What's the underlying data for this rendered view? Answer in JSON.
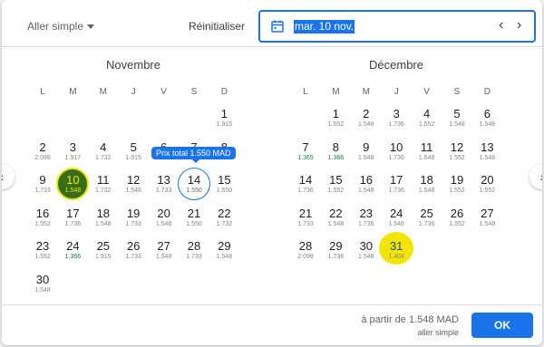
{
  "header": {
    "trip_type": "Aller simple",
    "reset_label": "Réinitialiser",
    "selected_date": "mar. 10 nov.",
    "prev_arrow": "‹",
    "next_arrow": "›"
  },
  "months": [
    {
      "title": "Novembre",
      "weekdays": [
        "L",
        "M",
        "M",
        "J",
        "V",
        "S",
        "D"
      ],
      "days": [
        {
          "d": "1",
          "p": "1.915",
          "row": 0,
          "col": 6
        },
        {
          "d": "2",
          "p": "2.098",
          "row": 1,
          "col": 0
        },
        {
          "d": "3",
          "p": "1.917",
          "row": 1,
          "col": 1
        },
        {
          "d": "4",
          "p": "1.732",
          "row": 1,
          "col": 2
        },
        {
          "d": "5",
          "p": "1.915",
          "row": 1,
          "col": 3
        },
        {
          "d": "6",
          "p": "",
          "row": 1,
          "col": 4
        },
        {
          "d": "7",
          "p": "",
          "row": 1,
          "col": 5
        },
        {
          "d": "8",
          "p": "",
          "row": 1,
          "col": 6
        },
        {
          "d": "9",
          "p": "1.733",
          "row": 2,
          "col": 0
        },
        {
          "d": "10",
          "p": "1.548",
          "row": 2,
          "col": 1,
          "selected": true
        },
        {
          "d": "11",
          "p": "1.732",
          "row": 2,
          "col": 2
        },
        {
          "d": "12",
          "p": "1.548",
          "row": 2,
          "col": 3
        },
        {
          "d": "13",
          "p": "1.733",
          "row": 2,
          "col": 4
        },
        {
          "d": "14",
          "p": "1.550",
          "row": 2,
          "col": 5,
          "hover": true
        },
        {
          "d": "15",
          "p": "1.550",
          "row": 2,
          "col": 6
        },
        {
          "d": "16",
          "p": "1.552",
          "row": 3,
          "col": 0
        },
        {
          "d": "17",
          "p": "1.736",
          "row": 3,
          "col": 1
        },
        {
          "d": "18",
          "p": "1.548",
          "row": 3,
          "col": 2
        },
        {
          "d": "19",
          "p": "1.733",
          "row": 3,
          "col": 3
        },
        {
          "d": "20",
          "p": "1.548",
          "row": 3,
          "col": 4
        },
        {
          "d": "21",
          "p": "1.550",
          "row": 3,
          "col": 5
        },
        {
          "d": "22",
          "p": "1.732",
          "row": 3,
          "col": 6
        },
        {
          "d": "23",
          "p": "1.552",
          "row": 4,
          "col": 0
        },
        {
          "d": "24",
          "p": "1.366",
          "row": 4,
          "col": 1,
          "low": true
        },
        {
          "d": "25",
          "p": "1.915",
          "row": 4,
          "col": 2
        },
        {
          "d": "26",
          "p": "1.733",
          "row": 4,
          "col": 3
        },
        {
          "d": "27",
          "p": "1.548",
          "row": 4,
          "col": 4
        },
        {
          "d": "28",
          "p": "1.733",
          "row": 4,
          "col": 5
        },
        {
          "d": "29",
          "p": "1.548",
          "row": 4,
          "col": 6
        },
        {
          "d": "30",
          "p": "1.548",
          "row": 5,
          "col": 0
        }
      ]
    },
    {
      "title": "Décembre",
      "weekdays": [
        "L",
        "M",
        "M",
        "J",
        "V",
        "S",
        "D"
      ],
      "days": [
        {
          "d": "1",
          "p": "1.552",
          "row": 0,
          "col": 1
        },
        {
          "d": "2",
          "p": "1.548",
          "row": 0,
          "col": 2
        },
        {
          "d": "3",
          "p": "1.736",
          "row": 0,
          "col": 3
        },
        {
          "d": "4",
          "p": "1.552",
          "row": 0,
          "col": 4
        },
        {
          "d": "5",
          "p": "1.548",
          "row": 0,
          "col": 5
        },
        {
          "d": "6",
          "p": "1.548",
          "row": 0,
          "col": 6
        },
        {
          "d": "7",
          "p": "1.365",
          "row": 1,
          "col": 0,
          "low": true
        },
        {
          "d": "8",
          "p": "1.366",
          "row": 1,
          "col": 1,
          "low": true
        },
        {
          "d": "9",
          "p": "1.548",
          "row": 1,
          "col": 2
        },
        {
          "d": "10",
          "p": "1.736",
          "row": 1,
          "col": 3
        },
        {
          "d": "11",
          "p": "1.548",
          "row": 1,
          "col": 4
        },
        {
          "d": "12",
          "p": "1.552",
          "row": 1,
          "col": 5
        },
        {
          "d": "13",
          "p": "1.548",
          "row": 1,
          "col": 6
        },
        {
          "d": "14",
          "p": "1.736",
          "row": 2,
          "col": 0
        },
        {
          "d": "15",
          "p": "1.552",
          "row": 2,
          "col": 1
        },
        {
          "d": "16",
          "p": "1.548",
          "row": 2,
          "col": 2
        },
        {
          "d": "17",
          "p": "1.736",
          "row": 2,
          "col": 3
        },
        {
          "d": "18",
          "p": "1.548",
          "row": 2,
          "col": 4
        },
        {
          "d": "19",
          "p": "1.552",
          "row": 2,
          "col": 5
        },
        {
          "d": "20",
          "p": "1.552",
          "row": 2,
          "col": 6
        },
        {
          "d": "21",
          "p": "1.733",
          "row": 3,
          "col": 0
        },
        {
          "d": "22",
          "p": "1.548",
          "row": 3,
          "col": 1
        },
        {
          "d": "23",
          "p": "1.736",
          "row": 3,
          "col": 2
        },
        {
          "d": "24",
          "p": "1.548",
          "row": 3,
          "col": 3
        },
        {
          "d": "25",
          "p": "1.736",
          "row": 3,
          "col": 4
        },
        {
          "d": "26",
          "p": "1.552",
          "row": 3,
          "col": 5
        },
        {
          "d": "27",
          "p": "1.548",
          "row": 3,
          "col": 6
        },
        {
          "d": "28",
          "p": "2.098",
          "row": 4,
          "col": 0
        },
        {
          "d": "29",
          "p": "1.736",
          "row": 4,
          "col": 1
        },
        {
          "d": "30",
          "p": "1.548",
          "row": 4,
          "col": 2
        },
        {
          "d": "31",
          "p": "1.404",
          "row": 4,
          "col": 3,
          "marked": true
        }
      ]
    }
  ],
  "tooltip": "Prix total 1.550 MAD",
  "side_nav": {
    "left": "‹",
    "right": "›"
  },
  "footer": {
    "price_text": "à partir de 1.548 MAD",
    "sub_text": "aller simple",
    "ok_label": "OK"
  },
  "colors": {
    "accent": "#1a73e8",
    "selected_fill": "#376d19",
    "highlight": "#f2e600",
    "low_price": "#188038"
  }
}
